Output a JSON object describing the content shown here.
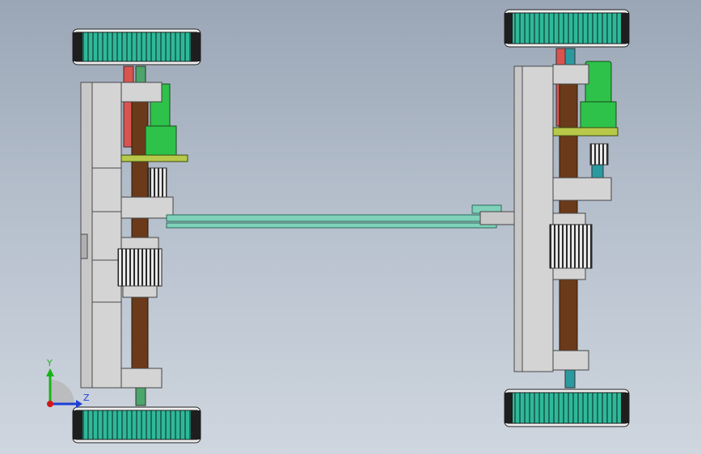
{
  "viewport": {
    "background_top": "#9aa6b6",
    "background_bottom": "#cfd6df"
  },
  "colors": {
    "tire_green": "#2fb89a",
    "tire_dark": "#1e1e1e",
    "frame_gray": "#c8c8c8",
    "frame_edge": "#4a4a4a",
    "shaft_brown": "#6b3a1a",
    "shaft_red": "#d9534f",
    "shaft_green": "#4ca56a",
    "shaft_teal": "#2a9aa0",
    "motor_green": "#2ec24a",
    "plate_olive": "#b8c94a",
    "rod_teal": "#7fd1b9"
  },
  "triad": {
    "y_label": "Y",
    "z_label": "Z",
    "y_color": "#19b319",
    "z_color": "#1e3fd6",
    "origin_color": "#d01818"
  },
  "icons": {
    "triad": "axis-triad-icon"
  }
}
